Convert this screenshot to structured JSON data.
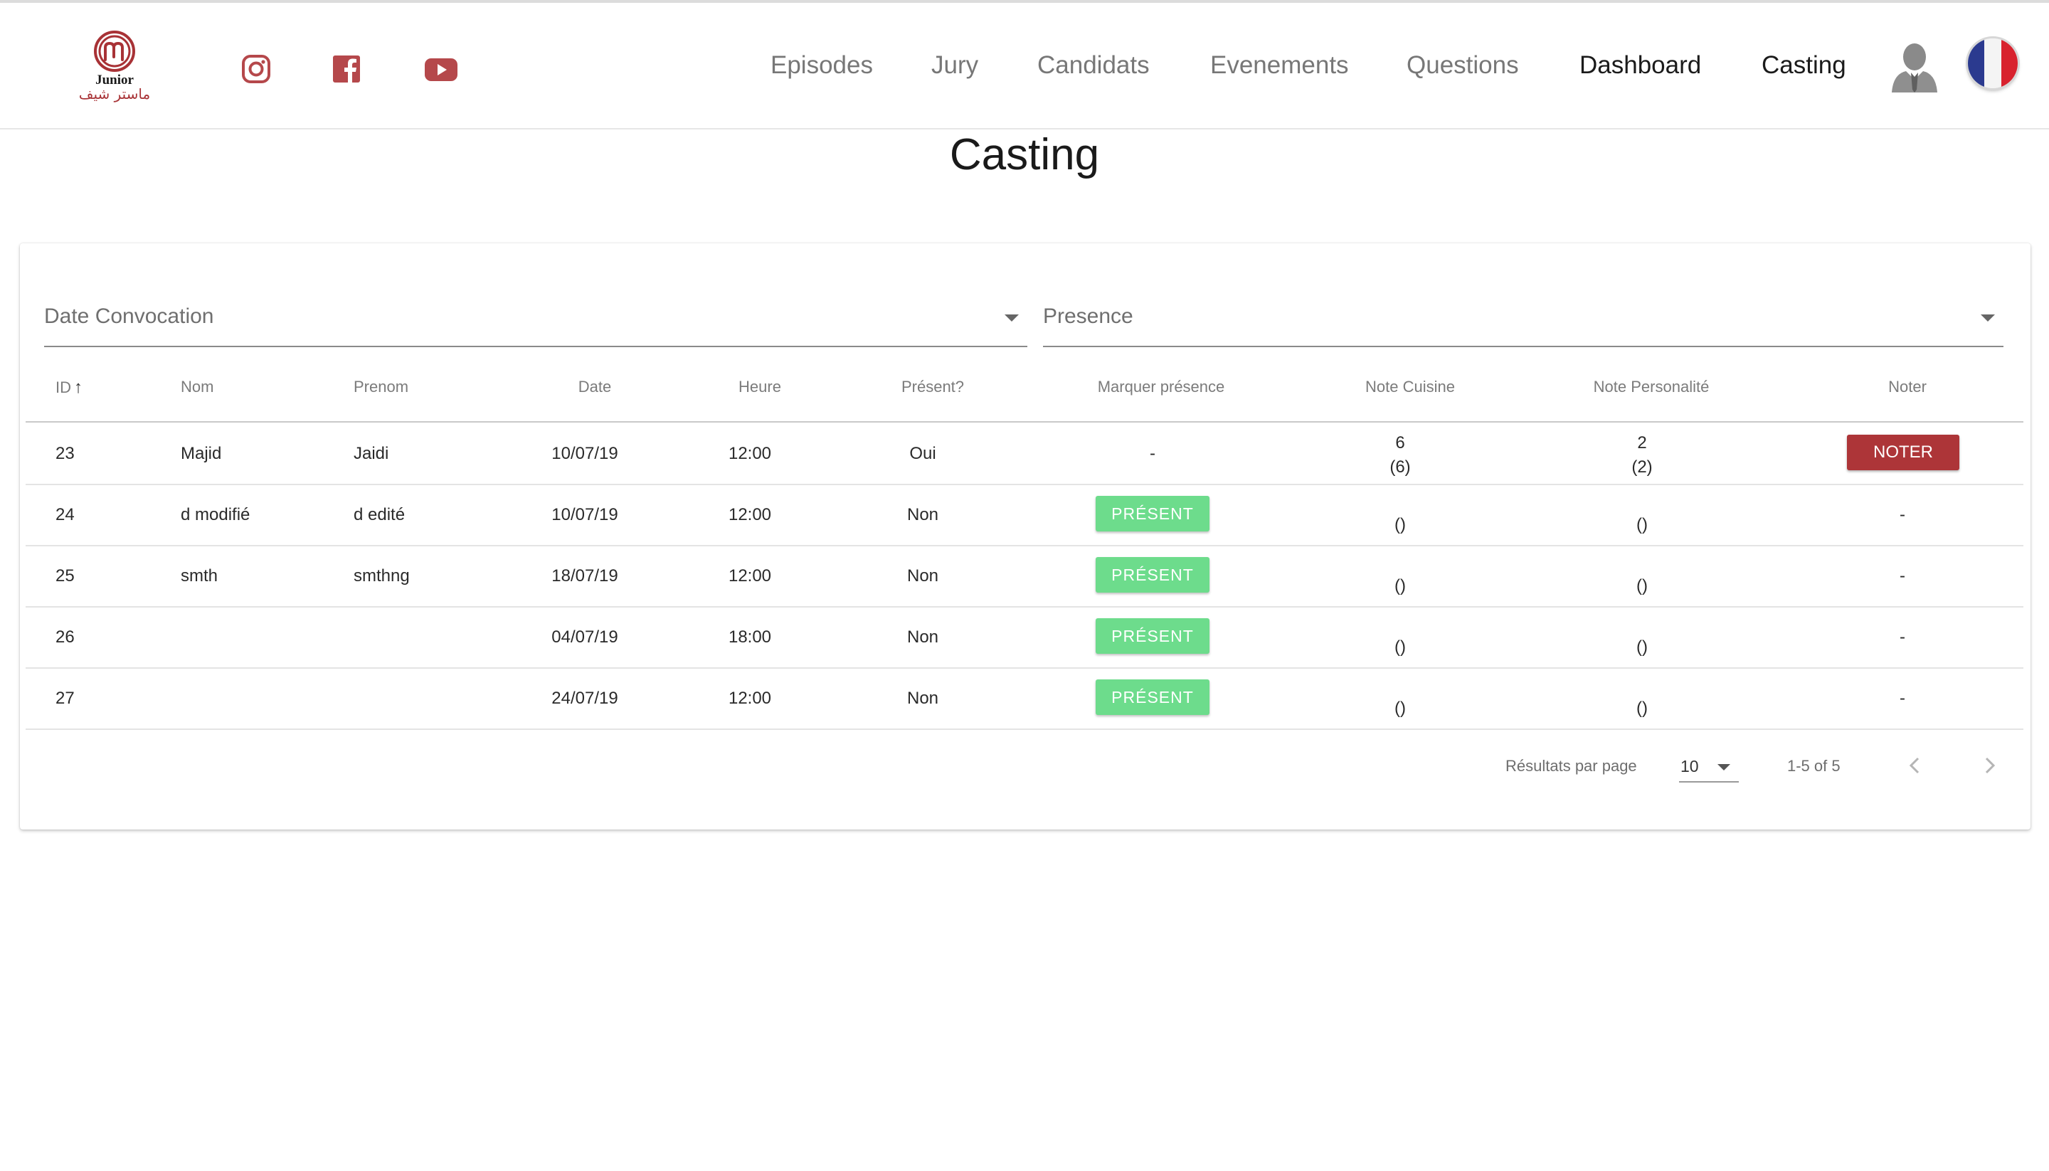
{
  "brand": {
    "logo_text_latin": "Junior",
    "logo_text_arabic": "ماستر شيف",
    "accent_color": "#a83236"
  },
  "social": [
    {
      "icon": "instagram-icon"
    },
    {
      "icon": "facebook-icon"
    },
    {
      "icon": "youtube-icon"
    }
  ],
  "nav": {
    "items": [
      {
        "label": "Episodes"
      },
      {
        "label": "Jury"
      },
      {
        "label": "Candidats"
      },
      {
        "label": "Evenements"
      },
      {
        "label": "Questions"
      },
      {
        "label": "Dashboard"
      },
      {
        "label": "Casting"
      }
    ],
    "user_icon": "user-avatar-icon",
    "language_icon": "french-flag-icon"
  },
  "page": {
    "title": "Casting"
  },
  "filters": {
    "date_convocation": "Date Convocation",
    "presence": "Presence"
  },
  "table": {
    "columns": [
      "ID",
      "Nom",
      "Prenom",
      "Date",
      "Heure",
      "Présent?",
      "Marquer présence",
      "Note Cuisine",
      "Note Personalité",
      "Noter"
    ],
    "sort": {
      "column": "ID",
      "direction": "ascending",
      "icon": "arrow-up-icon"
    },
    "rows": [
      {
        "id": "23",
        "nom": "Majid",
        "prenom": "Jaidi",
        "date": "10/07/19",
        "heure": "12:00",
        "present": "Oui",
        "marquer": "-",
        "note_cuisine": "6",
        "note_cuisine_sub": "(6)",
        "note_perso": "2",
        "note_perso_sub": "(2)",
        "noter": "NOTER"
      },
      {
        "id": "24",
        "nom": "d modifié",
        "prenom": "d edité",
        "date": "10/07/19",
        "heure": "12:00",
        "present": "Non",
        "marquer": "PRÉSENT",
        "note_cuisine": "",
        "note_cuisine_sub": "()",
        "note_perso": "",
        "note_perso_sub": "()",
        "noter": "-"
      },
      {
        "id": "25",
        "nom": "smth",
        "prenom": "smthng",
        "date": "18/07/19",
        "heure": "12:00",
        "present": "Non",
        "marquer": "PRÉSENT",
        "note_cuisine": "",
        "note_cuisine_sub": "()",
        "note_perso": "",
        "note_perso_sub": "()",
        "noter": "-"
      },
      {
        "id": "26",
        "nom": "",
        "prenom": "",
        "date": "04/07/19",
        "heure": "18:00",
        "present": "Non",
        "marquer": "PRÉSENT",
        "note_cuisine": "",
        "note_cuisine_sub": "()",
        "note_perso": "",
        "note_perso_sub": "()",
        "noter": "-"
      },
      {
        "id": "27",
        "nom": "",
        "prenom": "",
        "date": "24/07/19",
        "heure": "12:00",
        "present": "Non",
        "marquer": "PRÉSENT",
        "note_cuisine": "",
        "note_cuisine_sub": "()",
        "note_perso": "",
        "note_perso_sub": "()",
        "noter": "-"
      }
    ]
  },
  "pagination": {
    "label": "Résultats par page",
    "per_page": "10",
    "range": "1-5 of 5",
    "prev_icon": "chevron-left-icon",
    "next_icon": "chevron-right-icon"
  },
  "colors": {
    "present_button": "#6ddc8c",
    "noter_button": "#ad3538"
  }
}
